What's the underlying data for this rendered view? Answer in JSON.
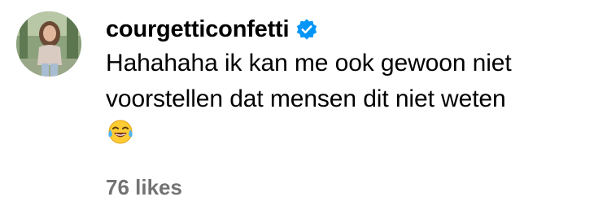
{
  "comment": {
    "username": "courgetticonfetti",
    "verified": true,
    "text": "Hahahaha ik kan me ook gewoon niet\nvoorstellen dat mensen dit niet weten",
    "emoji": "face-with-tears-of-joy",
    "likes": "76 likes"
  },
  "colors": {
    "verified_badge": "#0095f6",
    "likes_text": "#737373"
  }
}
